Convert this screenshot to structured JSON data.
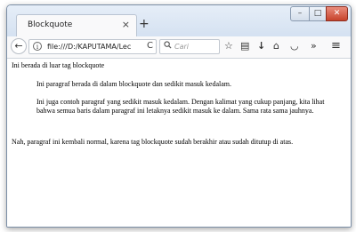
{
  "tab": {
    "title": "Blockquote",
    "close": "×",
    "new_tab": "+"
  },
  "window_controls": {
    "minimize": "–",
    "maximize": "□",
    "close": "✕"
  },
  "nav": {
    "back": "←",
    "info": "i",
    "url": "file:///D:/KAPUTAMA/Lec",
    "reload": "C",
    "search_icon": "🔍",
    "search_placeholder": "Cari"
  },
  "toolbar": {
    "bookmark": "☆",
    "reader": "▤",
    "download": "↓",
    "home": "⌂",
    "pocket": "◡",
    "overflow": "»",
    "menu": "≡"
  },
  "content": {
    "para1": "Ini berada di luar tag blockquote",
    "quote1": "Ini paragraf berada di dalam blockquote dan sedikit masuk kedalam.",
    "quote2": "Ini juga contoh paragraf yang sedikit masuk kedalam. Dengan kalimat yang cukup panjang, kita lihat bahwa semua baris dalam paragraf ini letaknya sedikit masuk ke dalam. Sama rata sama jauhnya.",
    "para2": "Nah, paragraf ini kembali normal, karena tag blockquote sudah berakhir atau sudah ditutup di atas."
  }
}
